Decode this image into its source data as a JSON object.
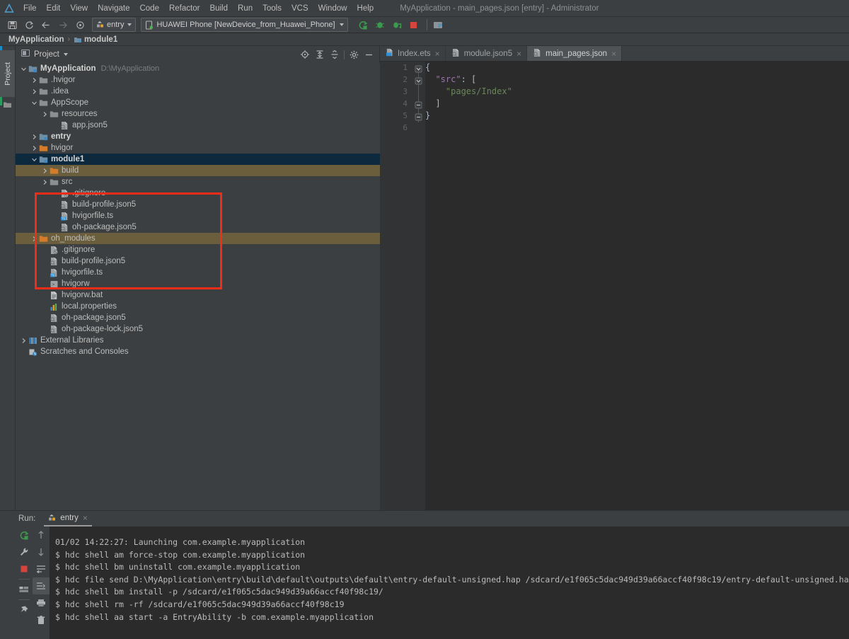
{
  "window": {
    "title": "MyApplication - main_pages.json [entry] - Administrator"
  },
  "menu": {
    "items": [
      {
        "label": "File"
      },
      {
        "label": "Edit"
      },
      {
        "label": "View"
      },
      {
        "label": "Navigate"
      },
      {
        "label": "Code"
      },
      {
        "label": "Refactor"
      },
      {
        "label": "Build"
      },
      {
        "label": "Run"
      },
      {
        "label": "Tools"
      },
      {
        "label": "VCS"
      },
      {
        "label": "Window"
      },
      {
        "label": "Help"
      }
    ]
  },
  "toolbar": {
    "save_icon": "save-icon",
    "sync_icon": "sync-icon",
    "back_icon": "arrow-left-icon",
    "forward_icon": "arrow-right-icon",
    "settings_icon": "target-icon",
    "run_config": "entry",
    "device": "HUAWEI Phone [NewDevice_from_Huawei_Phone]",
    "run_icon": "run-icon",
    "debug_icon": "debug-icon",
    "profile_icon": "run-profile-icon",
    "stop_icon": "stop-icon",
    "layout_icon": "device-manager-icon"
  },
  "breadcrumb": {
    "root": "MyApplication",
    "separator": "›",
    "current": "module1"
  },
  "left_rail": {
    "project_tab": "Project"
  },
  "project_panel": {
    "title": "Project",
    "tools": [
      {
        "name": "locate-icon"
      },
      {
        "name": "expand-all-icon"
      },
      {
        "name": "collapse-all-icon"
      },
      {
        "name": "gear-icon"
      },
      {
        "name": "minimize-icon"
      }
    ],
    "tree": [
      {
        "id": 0,
        "label": "MyApplication",
        "path": "D:\\MyApplication",
        "indent": 0,
        "twist": "down",
        "icon": "module-root",
        "bold": true,
        "state": "normal"
      },
      {
        "id": 1,
        "label": ".hvigor",
        "path": "",
        "indent": 1,
        "twist": "right",
        "icon": "folder",
        "bold": false,
        "state": "normal"
      },
      {
        "id": 2,
        "label": ".idea",
        "path": "",
        "indent": 1,
        "twist": "right",
        "icon": "folder",
        "bold": false,
        "state": "normal"
      },
      {
        "id": 3,
        "label": "AppScope",
        "path": "",
        "indent": 1,
        "twist": "down",
        "icon": "folder",
        "bold": false,
        "state": "normal"
      },
      {
        "id": 4,
        "label": "resources",
        "path": "",
        "indent": 2,
        "twist": "right",
        "icon": "folder",
        "bold": false,
        "state": "normal"
      },
      {
        "id": 5,
        "label": "app.json5",
        "path": "",
        "indent": 3,
        "twist": "none",
        "icon": "json-file",
        "bold": false,
        "state": "normal"
      },
      {
        "id": 6,
        "label": "entry",
        "path": "",
        "indent": 1,
        "twist": "right",
        "icon": "module-root",
        "bold": true,
        "state": "normal"
      },
      {
        "id": 7,
        "label": "hvigor",
        "path": "",
        "indent": 1,
        "twist": "right",
        "icon": "folder-excl",
        "bold": false,
        "state": "normal"
      },
      {
        "id": 8,
        "label": "module1",
        "path": "",
        "indent": 1,
        "twist": "down",
        "icon": "module-root",
        "bold": true,
        "state": "selected"
      },
      {
        "id": 9,
        "label": "build",
        "path": "",
        "indent": 2,
        "twist": "right",
        "icon": "folder-excl",
        "bold": false,
        "state": "highlight"
      },
      {
        "id": 10,
        "label": "src",
        "path": "",
        "indent": 2,
        "twist": "right",
        "icon": "folder",
        "bold": false,
        "state": "normal"
      },
      {
        "id": 11,
        "label": ".gitignore",
        "path": "",
        "indent": 3,
        "twist": "none",
        "icon": "git-file",
        "bold": false,
        "state": "normal"
      },
      {
        "id": 12,
        "label": "build-profile.json5",
        "path": "",
        "indent": 3,
        "twist": "none",
        "icon": "json-file",
        "bold": false,
        "state": "normal"
      },
      {
        "id": 13,
        "label": "hvigorfile.ts",
        "path": "",
        "indent": 3,
        "twist": "none",
        "icon": "ts-file",
        "bold": false,
        "state": "normal"
      },
      {
        "id": 14,
        "label": "oh-package.json5",
        "path": "",
        "indent": 3,
        "twist": "none",
        "icon": "json-file",
        "bold": false,
        "state": "normal"
      },
      {
        "id": 15,
        "label": "oh_modules",
        "path": "",
        "indent": 1,
        "twist": "right",
        "icon": "folder-excl",
        "bold": false,
        "state": "highlight"
      },
      {
        "id": 16,
        "label": ".gitignore",
        "path": "",
        "indent": 2,
        "twist": "none",
        "icon": "git-file",
        "bold": false,
        "state": "normal"
      },
      {
        "id": 17,
        "label": "build-profile.json5",
        "path": "",
        "indent": 2,
        "twist": "none",
        "icon": "json-file",
        "bold": false,
        "state": "normal"
      },
      {
        "id": 18,
        "label": "hvigorfile.ts",
        "path": "",
        "indent": 2,
        "twist": "none",
        "icon": "ts-file",
        "bold": false,
        "state": "normal"
      },
      {
        "id": 19,
        "label": "hvigorw",
        "path": "",
        "indent": 2,
        "twist": "none",
        "icon": "exec-file",
        "bold": false,
        "state": "normal"
      },
      {
        "id": 20,
        "label": "hvigorw.bat",
        "path": "",
        "indent": 2,
        "twist": "none",
        "icon": "bat-file",
        "bold": false,
        "state": "normal"
      },
      {
        "id": 21,
        "label": "local.properties",
        "path": "",
        "indent": 2,
        "twist": "none",
        "icon": "prop-file",
        "bold": false,
        "state": "normal"
      },
      {
        "id": 22,
        "label": "oh-package.json5",
        "path": "",
        "indent": 2,
        "twist": "none",
        "icon": "json-file",
        "bold": false,
        "state": "normal"
      },
      {
        "id": 23,
        "label": "oh-package-lock.json5",
        "path": "",
        "indent": 2,
        "twist": "none",
        "icon": "json-file",
        "bold": false,
        "state": "normal"
      },
      {
        "id": 24,
        "label": "External Libraries",
        "path": "",
        "indent": 0,
        "twist": "right",
        "icon": "library",
        "bold": false,
        "state": "normal"
      },
      {
        "id": 25,
        "label": "Scratches and Consoles",
        "path": "",
        "indent": 0,
        "twist": "none",
        "icon": "scratch",
        "bold": false,
        "state": "normal"
      }
    ]
  },
  "editor": {
    "tabs": [
      {
        "label": "Index.ets",
        "icon": "ets-file",
        "active": false,
        "close": "×"
      },
      {
        "label": "module.json5",
        "icon": "json-file",
        "active": false,
        "close": "×"
      },
      {
        "label": "main_pages.json",
        "icon": "json-file",
        "active": true,
        "close": "×"
      }
    ],
    "line_numbers": [
      "1",
      "2",
      "3",
      "4",
      "5",
      "6"
    ],
    "lines": [
      {
        "n": 1,
        "indent": 0,
        "tokens": [
          {
            "t": "{",
            "c": "pun"
          }
        ]
      },
      {
        "n": 2,
        "indent": 2,
        "tokens": [
          {
            "t": "\"src\"",
            "c": "key"
          },
          {
            "t": ": [",
            "c": "pun"
          }
        ]
      },
      {
        "n": 3,
        "indent": 4,
        "tokens": [
          {
            "t": "\"pages/Index\"",
            "c": "str"
          }
        ]
      },
      {
        "n": 4,
        "indent": 2,
        "tokens": [
          {
            "t": "]",
            "c": "pun"
          }
        ]
      },
      {
        "n": 5,
        "indent": 0,
        "tokens": [
          {
            "t": "}",
            "c": "pun"
          }
        ]
      },
      {
        "n": 6,
        "indent": 0,
        "tokens": []
      }
    ]
  },
  "run_panel": {
    "label": "Run:",
    "tab": "entry",
    "tab_close": "×",
    "side_buttons": [
      {
        "name": "rerun-icon"
      },
      {
        "name": "wrench-icon"
      },
      {
        "name": "stop-icon"
      },
      {
        "name": "layout-icon"
      },
      {
        "name": "pin-icon"
      }
    ],
    "side_buttons2": [
      {
        "name": "arrow-up-icon"
      },
      {
        "name": "arrow-down-icon"
      },
      {
        "name": "soft-wrap-icon"
      },
      {
        "name": "scroll-end-icon"
      },
      {
        "name": "print-icon"
      },
      {
        "name": "trash-icon"
      }
    ],
    "console": [
      "01/02 14:22:27: Launching com.example.myapplication",
      "$ hdc shell am force-stop com.example.myapplication",
      "$ hdc shell bm uninstall com.example.myapplication",
      "$ hdc file send D:\\MyApplication\\entry\\build\\default\\outputs\\default\\entry-default-unsigned.hap /sdcard/e1f065c5dac949d39a66accf40f98c19/entry-default-unsigned.hap",
      "$ hdc shell bm install -p /sdcard/e1f065c5dac949d39a66accf40f98c19/",
      "$ hdc shell rm -rf /sdcard/e1f065c5dac949d39a66accf40f98c19",
      "$ hdc shell aa start -a EntryAbility -b com.example.myapplication"
    ]
  },
  "annotation": {
    "color": "#f22c17",
    "shape": "rectangle"
  },
  "colors": {
    "selected_row": "#0d293e",
    "highlight_row": "#6b5e3c",
    "panel_bg": "#3c3f41",
    "editor_bg": "#2b2b2b",
    "annotation": "#f22c17"
  }
}
